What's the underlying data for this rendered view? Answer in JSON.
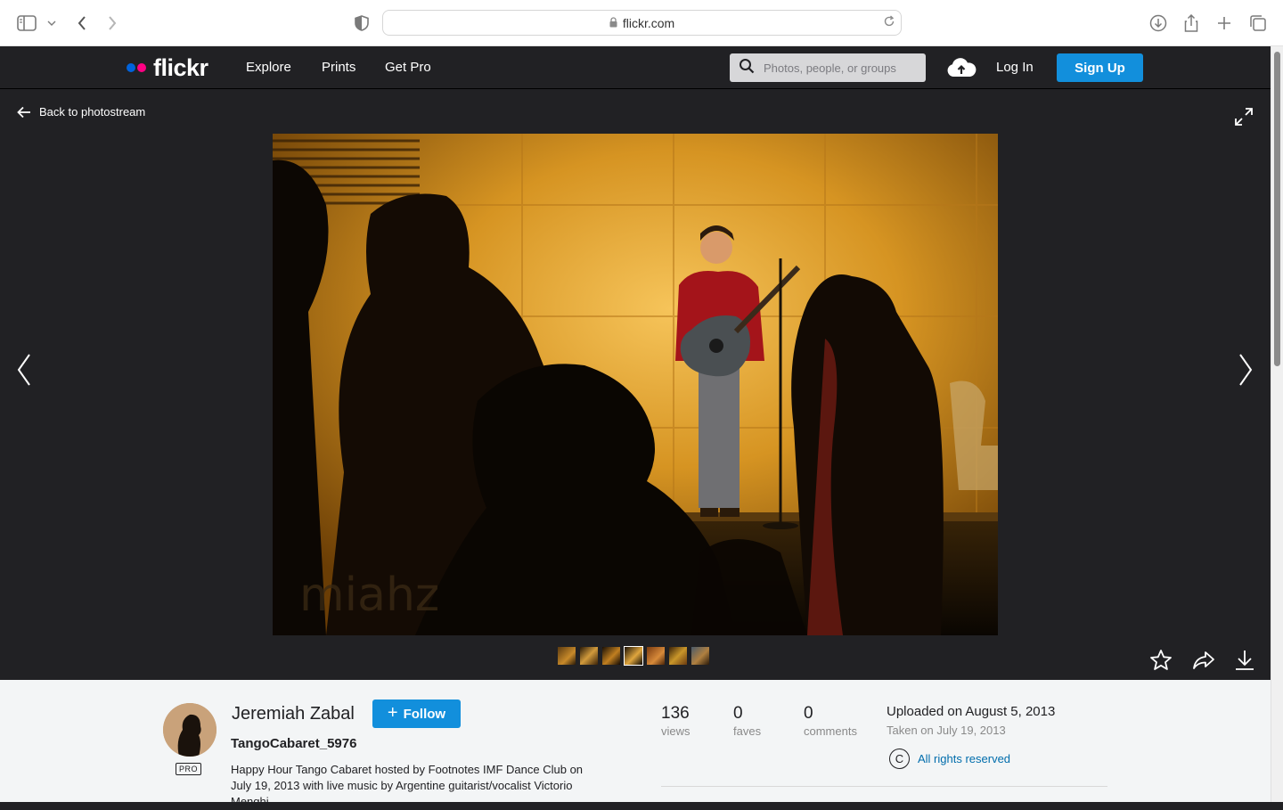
{
  "browser": {
    "url": "flickr.com"
  },
  "nav": {
    "links": [
      "Explore",
      "Prints",
      "Get Pro"
    ],
    "search_placeholder": "Photos, people, or groups",
    "login_label": "Log In",
    "signup_label": "Sign Up"
  },
  "stage": {
    "back_label": "Back to photostream",
    "watermark": "miahz"
  },
  "info": {
    "author": "Jeremiah Zabal",
    "pro_badge": "PRO",
    "follow_label": "Follow",
    "photo_title": "TangoCabaret_5976",
    "description": "Happy Hour Tango Cabaret hosted by Footnotes IMF Dance Club on July 19, 2013 with live music by Argentine guitarist/vocalist Victorio Menghi",
    "stats": [
      {
        "value": "136",
        "label": "views"
      },
      {
        "value": "0",
        "label": "faves"
      },
      {
        "value": "0",
        "label": "comments"
      }
    ],
    "uploaded": "Uploaded on August 5, 2013",
    "taken": "Taken on July 19, 2013",
    "rights_symbol": "C",
    "rights": "All rights reserved"
  }
}
